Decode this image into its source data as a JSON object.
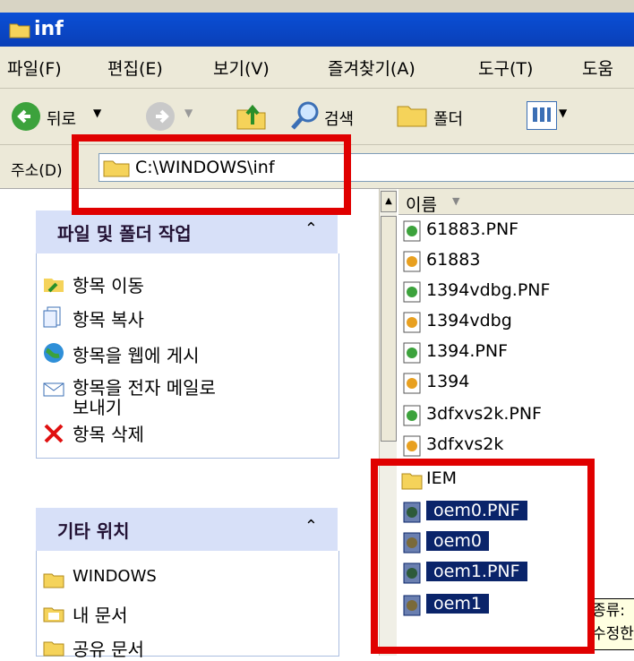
{
  "window": {
    "title": "inf"
  },
  "menu": [
    "파일(F)",
    "편집(E)",
    "보기(V)",
    "즐겨찾기(A)",
    "도구(T)",
    "도움"
  ],
  "toolbar": {
    "back": "뒤로",
    "search": "검색",
    "folders": "폴더"
  },
  "address": {
    "label": "주소(D)",
    "value": "C:\\WINDOWS\\inf"
  },
  "tasks_panel": {
    "title": "파일 및 폴더 작업",
    "items": [
      "항목 이동",
      "항목 복사",
      "항목을 웹에 게시",
      "항목을 전자 메일로",
      "보내기",
      "항목 삭제"
    ]
  },
  "places_panel": {
    "title": "기타 위치",
    "items": [
      "WINDOWS",
      "내 문서",
      "공유 문서"
    ]
  },
  "file_list": {
    "column": "이름",
    "items": [
      {
        "name": "61883.PNF",
        "type": "pnf"
      },
      {
        "name": "61883",
        "type": "inf"
      },
      {
        "name": "1394vdbg.PNF",
        "type": "pnf"
      },
      {
        "name": "1394vdbg",
        "type": "inf"
      },
      {
        "name": "1394.PNF",
        "type": "pnf"
      },
      {
        "name": "1394",
        "type": "inf"
      },
      {
        "name": "3dfxvs2k.PNF",
        "type": "pnf"
      },
      {
        "name": "3dfxvs2k",
        "type": "inf"
      },
      {
        "name": "IEM",
        "type": "folder"
      },
      {
        "name": "oem0.PNF",
        "type": "pnf",
        "selected": true
      },
      {
        "name": "oem0",
        "type": "inf",
        "selected": true
      },
      {
        "name": "oem1.PNF",
        "type": "pnf",
        "selected": true
      },
      {
        "name": "oem1",
        "type": "inf",
        "selected": true
      }
    ]
  },
  "tooltip": {
    "line1": "종류:",
    "line2": "수정한"
  },
  "colors": {
    "title_bar": "#0a3fb7",
    "selection": "#0a246a",
    "highlight_red": "#e00000"
  }
}
